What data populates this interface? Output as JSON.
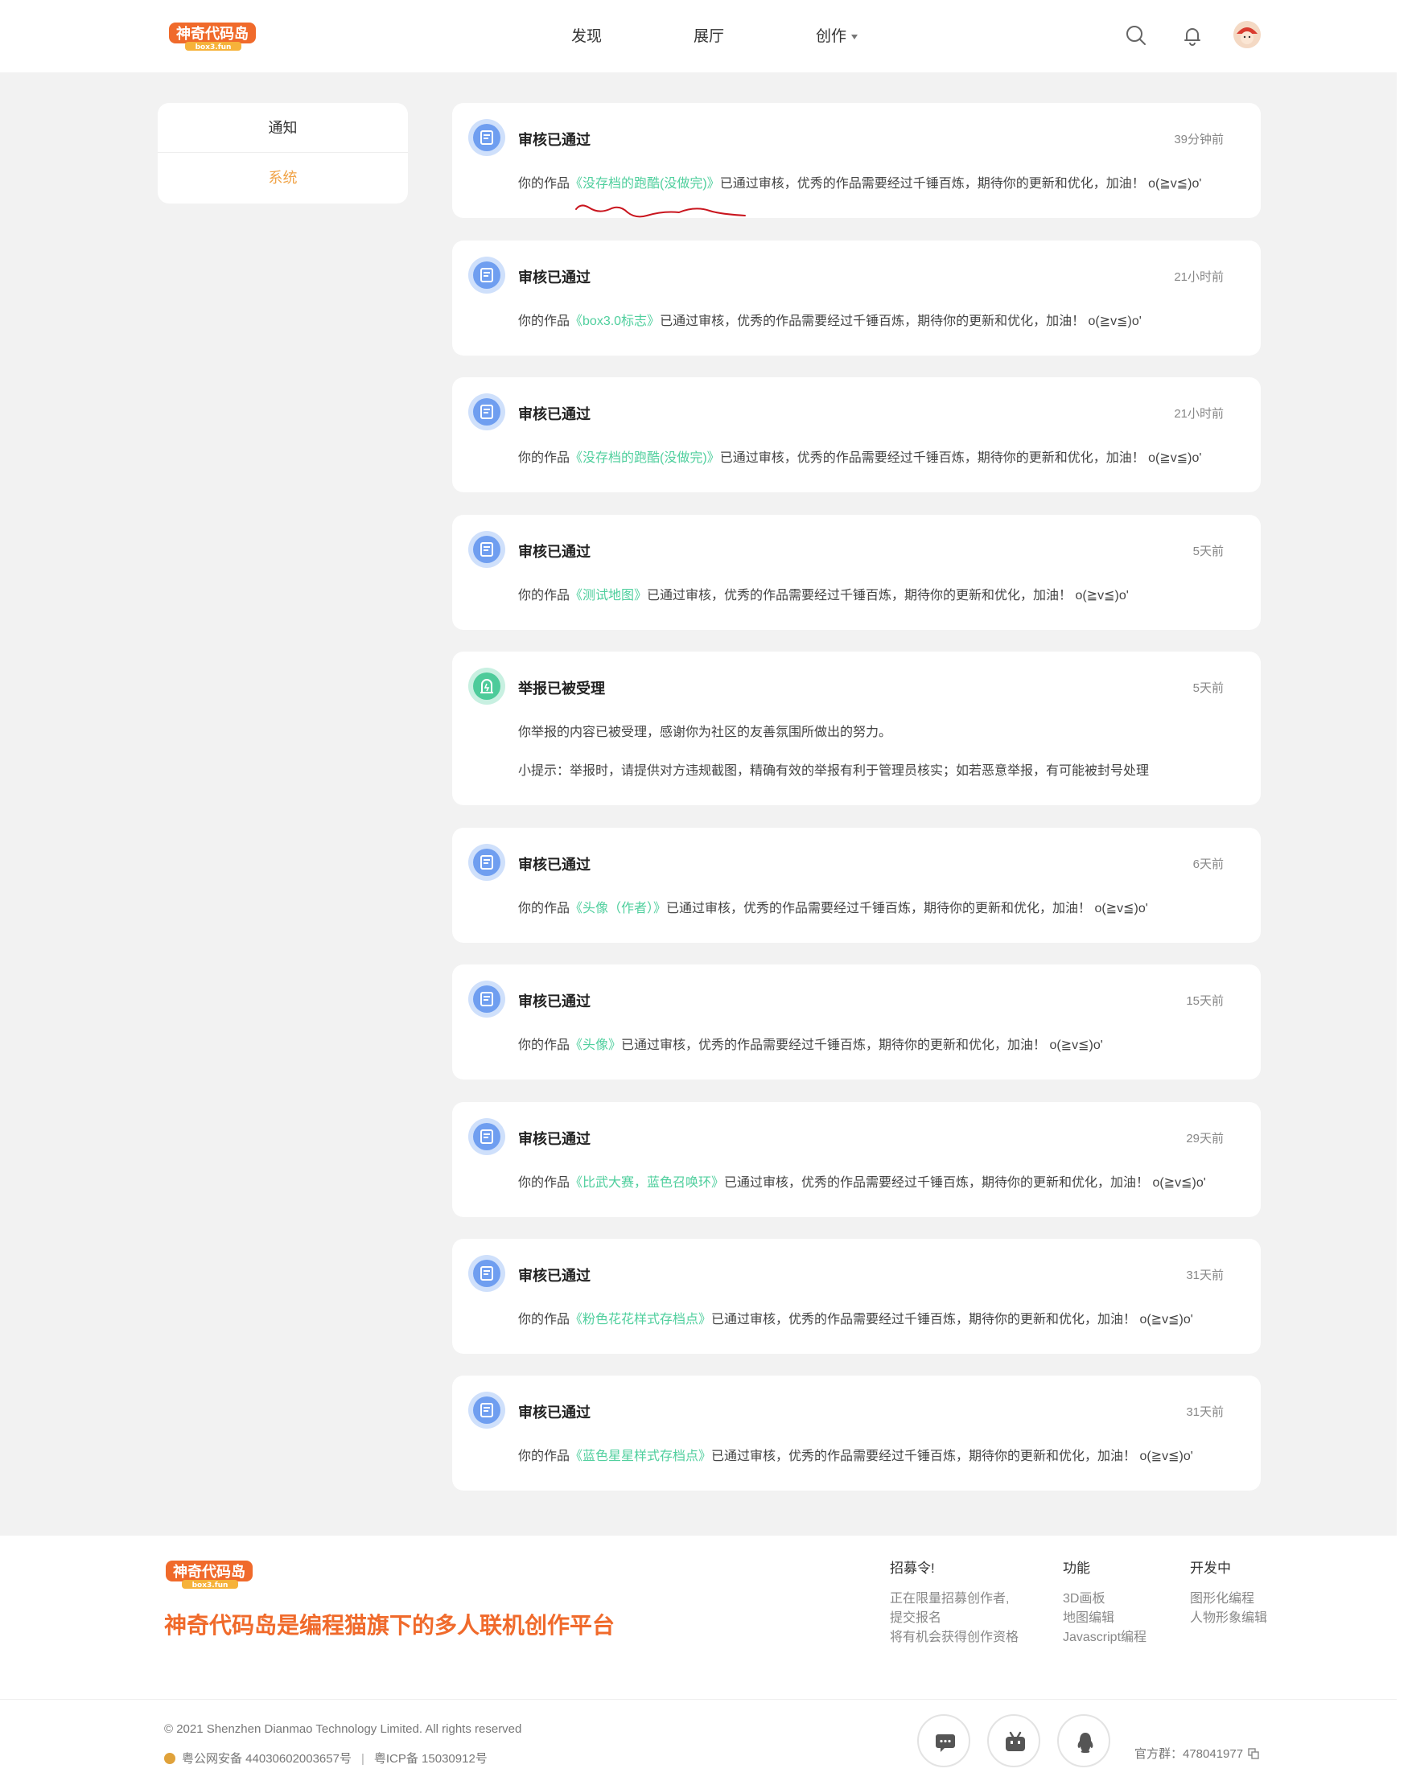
{
  "header": {
    "logo_text": "神奇代码岛",
    "logo_sub": "box3.fun",
    "nav": {
      "discover": "发现",
      "hall": "展厅",
      "create": "创作"
    }
  },
  "sidebar": {
    "items": [
      {
        "label": "通知"
      },
      {
        "label": "系统"
      }
    ]
  },
  "messages": [
    {
      "title": "审核已通过",
      "time": "39分钟前",
      "prefix": "你的作品",
      "work": "《没存档的跑酷(没做完)》",
      "suffix": "已通过审核，优秀的作品需要经过千锤百炼，期待你的更新和优化，加油！ o(≧v≦)o'"
    },
    {
      "title": "审核已通过",
      "time": "21小时前",
      "prefix": "你的作品",
      "work": "《box3.0标志》",
      "suffix": "已通过审核，优秀的作品需要经过千锤百炼，期待你的更新和优化，加油！ o(≧v≦)o'"
    },
    {
      "title": "审核已通过",
      "time": "21小时前",
      "prefix": "你的作品",
      "work": "《没存档的跑酷(没做完)》",
      "suffix": "已通过审核，优秀的作品需要经过千锤百炼，期待你的更新和优化，加油！ o(≧v≦)o'"
    },
    {
      "title": "审核已通过",
      "time": "5天前",
      "prefix": "你的作品",
      "work": "《测试地图》",
      "suffix": "已通过审核，优秀的作品需要经过千锤百炼，期待你的更新和优化，加油！ o(≧v≦)o'"
    },
    {
      "title": "举报已被受理",
      "time": "5天前",
      "body": "你举报的内容已被受理，感谢你为社区的友善氛围所做出的努力。",
      "tip": "小提示：举报时，请提供对方违规截图，精确有效的举报有利于管理员核实；如若恶意举报，有可能被封号处理"
    },
    {
      "title": "审核已通过",
      "time": "6天前",
      "prefix": "你的作品",
      "work": "《头像（作者）》",
      "suffix": "已通过审核，优秀的作品需要经过千锤百炼，期待你的更新和优化，加油！ o(≧v≦)o'"
    },
    {
      "title": "审核已通过",
      "time": "15天前",
      "prefix": "你的作品",
      "work": "《头像》",
      "suffix": "已通过审核，优秀的作品需要经过千锤百炼，期待你的更新和优化，加油！ o(≧v≦)o'"
    },
    {
      "title": "审核已通过",
      "time": "29天前",
      "prefix": "你的作品",
      "work": "《比武大赛，蓝色召唤环》",
      "suffix": "已通过审核，优秀的作品需要经过千锤百炼，期待你的更新和优化，加油！ o(≧v≦)o'"
    },
    {
      "title": "审核已通过",
      "time": "31天前",
      "prefix": "你的作品",
      "work": "《粉色花花样式存档点》",
      "suffix": "已通过审核，优秀的作品需要经过千锤百炼，期待你的更新和优化，加油！ o(≧v≦)o'"
    },
    {
      "title": "审核已通过",
      "time": "31天前",
      "prefix": "你的作品",
      "work": "《蓝色星星样式存档点》",
      "suffix": "已通过审核，优秀的作品需要经过千锤百炼，期待你的更新和优化，加油！ o(≧v≦)o'"
    }
  ],
  "footer": {
    "logo_text": "神奇代码岛",
    "logo_sub": "box3.fun",
    "slogan": "神奇代码岛是编程猫旗下的多人联机创作平台",
    "columns": [
      {
        "title": "招募令!",
        "items": [
          "正在限量招募创作者,",
          "提交报名",
          "将有机会获得创作资格"
        ]
      },
      {
        "title": "功能",
        "items": [
          "3D画板",
          "地图编辑",
          "Javascript编程"
        ]
      },
      {
        "title": "开发中",
        "items": [
          "图形化编程",
          "人物形象编辑"
        ]
      }
    ],
    "copyright": "© 2021 Shenzhen Dianmao Technology Limited. All rights reserved",
    "police_beian": "粤公网安备 44030602003657号",
    "icp_beian": "粤ICP备 15030912号",
    "qq_group": "官方群：478041977"
  },
  "colors": {
    "accent_orange": "#f0a347",
    "link_green": "#4fcf9d",
    "slogan_orange": "#f06a2b",
    "icon_blue": "#6f9ef0",
    "icon_green": "#4dcb9a"
  },
  "icons": [
    "search-icon",
    "bell-icon",
    "document-icon",
    "report-icon",
    "chat-icon",
    "bilibili-icon",
    "qq-icon",
    "copy-icon"
  ]
}
